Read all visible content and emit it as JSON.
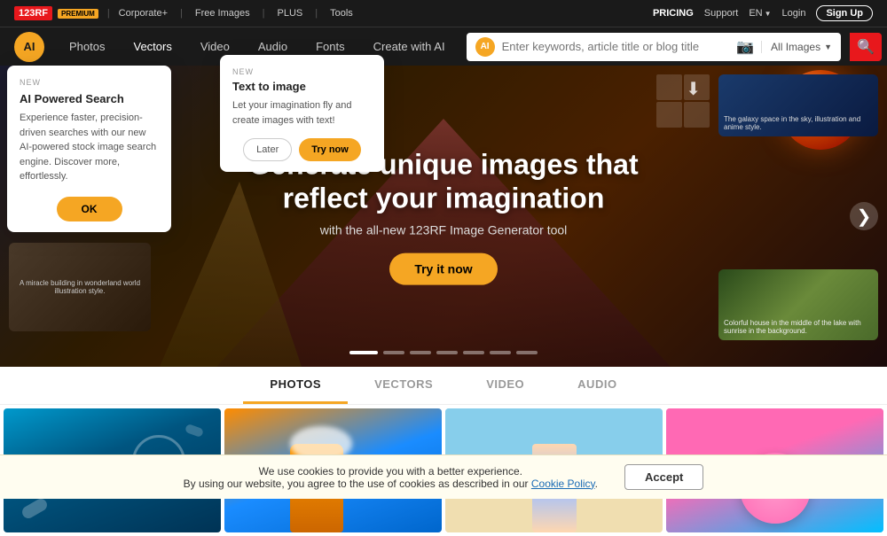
{
  "topnav": {
    "logo": "123RF",
    "premium_badge": "PREMIUM",
    "links": [
      "Corporate+",
      "Free Images",
      "PLUS",
      "Tools"
    ],
    "right_links": {
      "pricing": "PRICING",
      "support": "Support",
      "lang": "EN",
      "login": "Login",
      "signup": "Sign Up"
    }
  },
  "mainnav": {
    "ai_icon_label": "AI",
    "search_placeholder": "Enter keywords, article title or blog title",
    "links": [
      "Photos",
      "Vectors",
      "Video",
      "Audio",
      "Fonts",
      "Create with AI"
    ],
    "all_images_label": "All Images",
    "camera_icon": "📷"
  },
  "hero": {
    "title": "Generate unique images that reflect your imagination",
    "subtitle": "with the all-new 123RF Image Generator tool",
    "cta_label": "Try it now",
    "next_label": "❯",
    "download_icon": "⬇",
    "right_caption_top": "The galaxy space in the sky, illustration and anime style.",
    "right_caption_bottom": "Colorful house in the middle of the lake with sunrise in the background.",
    "left_caption": "A miracle building in wonderland world illustration style.",
    "dots": [
      1,
      2,
      3,
      4,
      5,
      6,
      7
    ]
  },
  "ai_popup": {
    "new_label": "NEW",
    "title": "AI Powered Search",
    "description": "Experience faster, precision-driven searches with our new AI-powered stock image search engine. Discover more, effortlessly.",
    "ok_label": "OK"
  },
  "tti_popup": {
    "new_label": "NEW",
    "title": "Text to image",
    "description": "Let your imagination fly and create images with text!",
    "later_label": "Later",
    "try_label": "Try now"
  },
  "tabs": {
    "items": [
      "PHOTOS",
      "VECTORS",
      "VIDEO",
      "AUDIO"
    ],
    "active_index": 0
  },
  "photo_grid": {
    "cells": [
      {
        "id": 1,
        "class": "photo-ocean",
        "alt": "Ocean aerial view"
      },
      {
        "id": 2,
        "class": "photo-glove",
        "alt": "Orange glove cleaning"
      },
      {
        "id": 3,
        "class": "photo-beach",
        "alt": "Girl at beach with sunscreen"
      },
      {
        "id": 4,
        "class": "photo-icecream",
        "alt": "Ice cream figures on pink"
      }
    ]
  },
  "cookie": {
    "text1": "We use cookies to provide you with a better experience.",
    "text2": "By using our website, you agree to the use of cookies as described in our",
    "link_text": "Cookie Policy",
    "accept_label": "Accept"
  }
}
